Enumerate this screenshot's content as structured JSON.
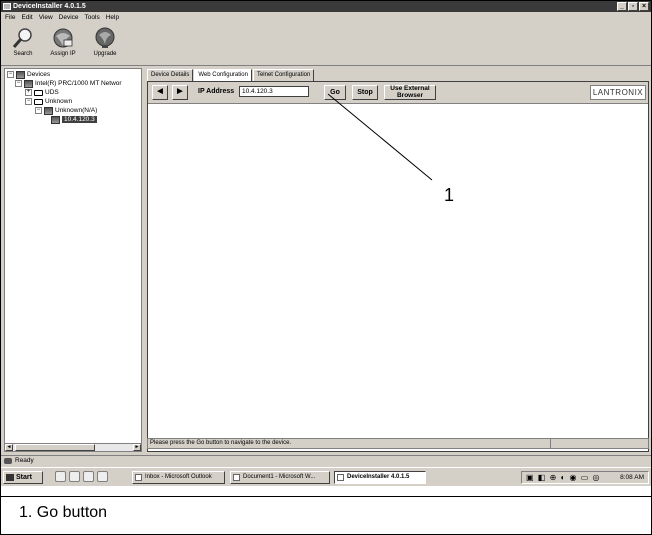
{
  "window": {
    "title": "DeviceInstaller 4.0.1.5",
    "controls": [
      "_",
      "▫",
      "×"
    ]
  },
  "menu": [
    "File",
    "Edit",
    "View",
    "Device",
    "Tools",
    "Help"
  ],
  "toolbar": {
    "search_label": "Search",
    "assign_ip_label": "Assign IP",
    "upgrade_label": "Upgrade"
  },
  "tree": {
    "root": "Devices",
    "adapter": "Intel(R) PRC/1000 MT Networ",
    "uds": "UDS",
    "unknown": "Unknown",
    "unknown_na": "Unknown(N/A)",
    "device_ip": "10.4.120.3"
  },
  "tabs": [
    "Device Details",
    "Web Configuration",
    "Telnet Configuration"
  ],
  "active_tab": "Web Configuration",
  "webbar": {
    "back": "◄",
    "forward": "►",
    "ip_label": "IP Address",
    "ip_value": "10.4.120.3",
    "go_label": "Go",
    "stop_label": "Stop",
    "external_line1": "Use External",
    "external_line2": "Browser",
    "brand": "LANTRONIX"
  },
  "status_message": "Please press the Go button to navigate to the device.",
  "ready": "Ready",
  "taskbar": {
    "start": "Start",
    "items": [
      "Inbox - Microsoft Outlook",
      "Document1 - Microsoft W...",
      "DeviceInstaller 4.0.1.5"
    ],
    "clock": "8:08 AM"
  },
  "callout": {
    "number": "1",
    "caption": "1.  Go button"
  }
}
